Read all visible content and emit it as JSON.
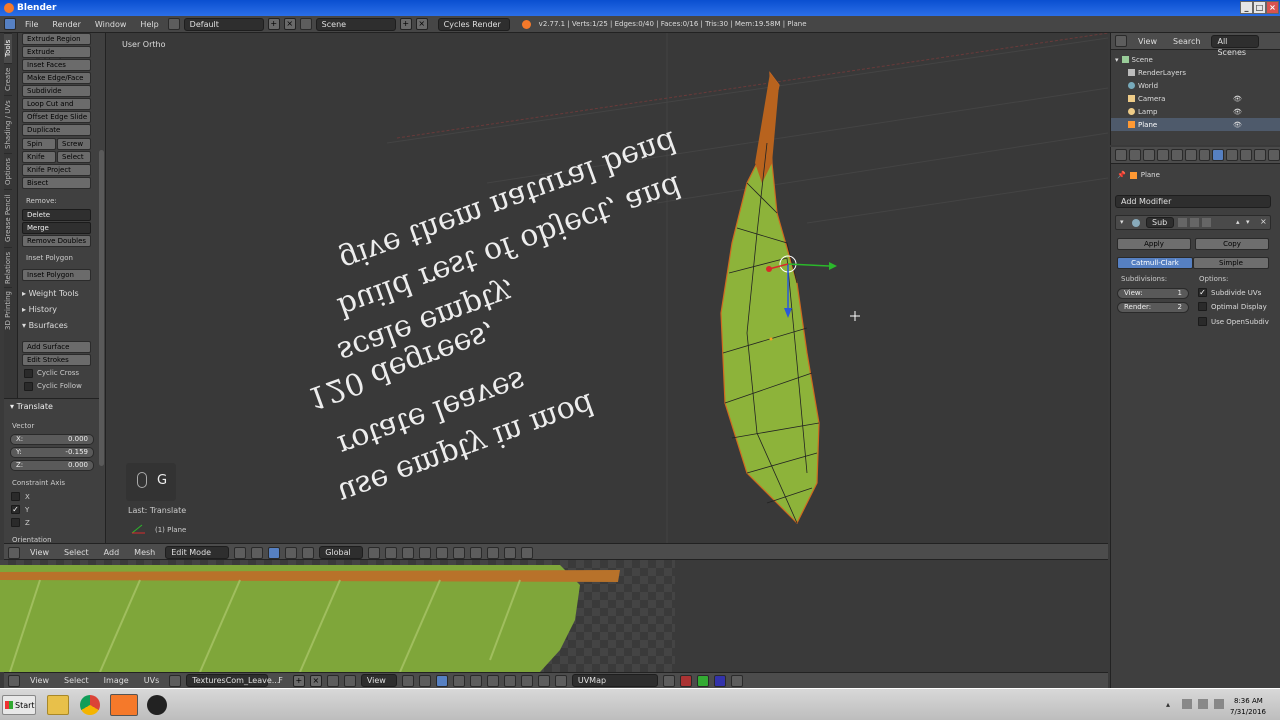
{
  "window": {
    "title": "Blender"
  },
  "menubar": {
    "menus": [
      "File",
      "Render",
      "Window",
      "Help"
    ],
    "layout": "Default",
    "scene": "Scene",
    "engine": "Cycles Render",
    "stats": "v2.77.1 | Verts:1/25 | Edges:0/40 | Faces:0/16 | Tris:30 | Mem:19.58M | Plane"
  },
  "toolshelf": {
    "tabs": [
      "Tools",
      "Create",
      "Shading / UVs",
      "Options",
      "Grease Pencil",
      "Relations",
      "3D Printing"
    ],
    "mesh_tools": [
      "Extrude Region",
      "Extrude Individual",
      "Inset Faces",
      "Make Edge/Face",
      "Subdivide",
      "Loop Cut and Slide",
      "Offset Edge Slide",
      "Duplicate"
    ],
    "spin": "Spin",
    "screw": "Screw",
    "knife": "Knife",
    "select": "Select",
    "knife_project": "Knife Project",
    "bisect": "Bisect",
    "remove_label": "Remove:",
    "delete": "Delete",
    "merge": "Merge",
    "remove_doubles": "Remove Doubles",
    "inset_polygon_1": "Inset Polygon",
    "inset_polygon_2": "Inset Polygon",
    "weight_tools": "Weight Tools",
    "history": "History",
    "bsurfaces": "Bsurfaces",
    "add_surface": "Add Surface",
    "edit_strokes": "Edit Strokes",
    "cyclic_cross": "Cyclic Cross",
    "cyclic_follow": "Cyclic Follow"
  },
  "operator": {
    "title": "Translate",
    "vector_label": "Vector",
    "x_label": "X:",
    "x": "0.000",
    "y_label": "Y:",
    "y": "-0.159",
    "z_label": "Z:",
    "z": "0.000",
    "constraint_label": "Constraint Axis",
    "axis_x": "X",
    "axis_y": "Y",
    "axis_z": "Z",
    "axis_x_checked": false,
    "axis_y_checked": true,
    "axis_z_checked": false,
    "orientation_label": "Orientation"
  },
  "viewport": {
    "view_label": "User Ortho",
    "key_hint": "G",
    "last_op": "Last: Translate",
    "text_lines": [
      "give them natural bend",
      "build rest of object, and",
      "scale empty,",
      "120 degrees,",
      "rotate leaves",
      "use empty in mod"
    ],
    "object_label": "(1) Plane"
  },
  "view3d_header": {
    "menus": [
      "View",
      "Select",
      "Add",
      "Mesh"
    ],
    "mode": "Edit Mode",
    "orientation": "Global"
  },
  "uv_header": {
    "menus": [
      "View",
      "Select",
      "Image",
      "UVs"
    ],
    "image": "TexturesCom_Leave...",
    "f_label": "F",
    "view_btn": "View",
    "uvmap": "UVMap"
  },
  "outliner": {
    "menus": [
      "View",
      "Search"
    ],
    "filter": "All Scenes",
    "items": [
      "Scene",
      "RenderLayers",
      "World",
      "Camera",
      "Lamp",
      "Plane"
    ],
    "selected": "Plane"
  },
  "properties": {
    "context": "Plane",
    "add_modifier": "Add Modifier",
    "modifier_name": "Sub",
    "apply": "Apply",
    "copy": "Copy",
    "catmull": "Catmull-Clark",
    "simple": "Simple",
    "subdivisions_label": "Subdivisions:",
    "options_label": "Options:",
    "view_field_label": "View:",
    "view_value": "1",
    "render_field_label": "Render:",
    "render_value": "2",
    "opt_subdivide_uvs": "Subdivide UVs",
    "opt_optimal_display": "Optimal Display",
    "opt_opensubdiv": "Use OpenSubdiv",
    "subdivide_uvs_checked": true,
    "optimal_display_checked": false,
    "opensubdiv_checked": false
  },
  "taskbar": {
    "start": "Start",
    "time": "8:36 AM",
    "date": "7/31/2016"
  },
  "colors": {
    "blender_blue": "#5680c2",
    "titlebar": "#1a5fe0",
    "leaf_green": "#8db33a",
    "orange_edge": "#d06a20"
  }
}
